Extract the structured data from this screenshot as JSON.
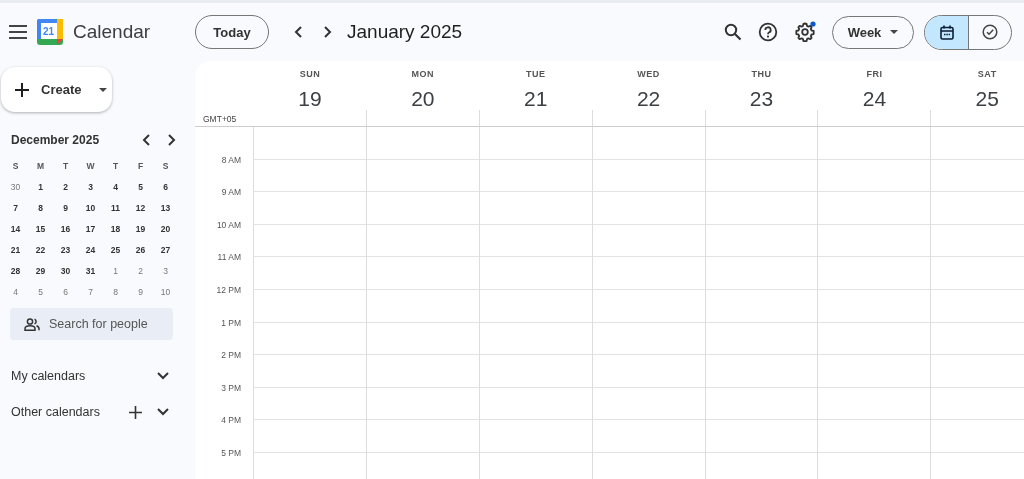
{
  "header": {
    "app_name": "Calendar",
    "logo_day": "21",
    "today_button": "Today",
    "period_title": "January 2025",
    "settings_badge": true,
    "view_menu": "Week",
    "view_toggle": [
      {
        "kind": "calendar",
        "selected": true
      },
      {
        "kind": "tasks",
        "selected": false
      }
    ]
  },
  "sidebar": {
    "create_button": "Create",
    "mini_calendar": {
      "title": "December 2025",
      "weekdays": [
        "S",
        "M",
        "T",
        "W",
        "T",
        "F",
        "S"
      ],
      "weeks": [
        [
          {
            "label": "30",
            "muted": true
          },
          {
            "label": "1",
            "muted": false
          },
          {
            "label": "2",
            "muted": false
          },
          {
            "label": "3",
            "muted": false
          },
          {
            "label": "4",
            "muted": false
          },
          {
            "label": "5",
            "muted": false
          },
          {
            "label": "6",
            "muted": false
          }
        ],
        [
          {
            "label": "7",
            "muted": false
          },
          {
            "label": "8",
            "muted": false
          },
          {
            "label": "9",
            "muted": false
          },
          {
            "label": "10",
            "muted": false
          },
          {
            "label": "11",
            "muted": false
          },
          {
            "label": "12",
            "muted": false
          },
          {
            "label": "13",
            "muted": false
          }
        ],
        [
          {
            "label": "14",
            "muted": false
          },
          {
            "label": "15",
            "muted": false
          },
          {
            "label": "16",
            "muted": false
          },
          {
            "label": "17",
            "muted": false
          },
          {
            "label": "18",
            "muted": false
          },
          {
            "label": "19",
            "muted": false
          },
          {
            "label": "20",
            "muted": false
          }
        ],
        [
          {
            "label": "21",
            "muted": false
          },
          {
            "label": "22",
            "muted": false
          },
          {
            "label": "23",
            "muted": false
          },
          {
            "label": "24",
            "muted": false
          },
          {
            "label": "25",
            "muted": false
          },
          {
            "label": "26",
            "muted": false
          },
          {
            "label": "27",
            "muted": false
          }
        ],
        [
          {
            "label": "28",
            "muted": false
          },
          {
            "label": "29",
            "muted": false
          },
          {
            "label": "30",
            "muted": false
          },
          {
            "label": "31",
            "muted": false
          },
          {
            "label": "1",
            "muted": true
          },
          {
            "label": "2",
            "muted": true
          },
          {
            "label": "3",
            "muted": true
          }
        ],
        [
          {
            "label": "4",
            "muted": true
          },
          {
            "label": "5",
            "muted": true
          },
          {
            "label": "6",
            "muted": true
          },
          {
            "label": "7",
            "muted": true
          },
          {
            "label": "8",
            "muted": true
          },
          {
            "label": "9",
            "muted": true
          },
          {
            "label": "10",
            "muted": true
          }
        ]
      ]
    },
    "people_search": {
      "placeholder": "Search for people"
    },
    "sections": [
      {
        "label": "My calendars",
        "can_add": false,
        "expanded": false
      },
      {
        "label": "Other calendars",
        "can_add": true,
        "expanded": false
      }
    ]
  },
  "week_view": {
    "timezone": "GMT+05",
    "days": [
      {
        "weekday": "SUN",
        "date": "19"
      },
      {
        "weekday": "MON",
        "date": "20"
      },
      {
        "weekday": "TUE",
        "date": "21"
      },
      {
        "weekday": "WED",
        "date": "22"
      },
      {
        "weekday": "THU",
        "date": "23"
      },
      {
        "weekday": "FRI",
        "date": "24"
      },
      {
        "weekday": "SAT",
        "date": "25"
      }
    ],
    "hours": [
      "8 AM",
      "9 AM",
      "10 AM",
      "11 AM",
      "12 PM",
      "1 PM",
      "2 PM",
      "3 PM",
      "4 PM",
      "5 PM"
    ]
  }
}
